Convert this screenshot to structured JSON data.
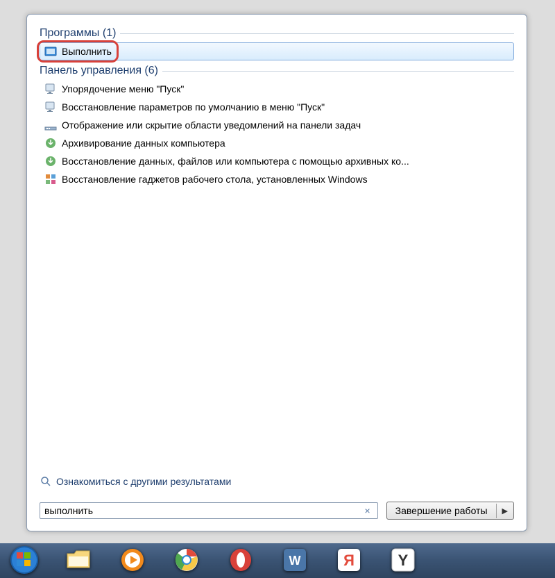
{
  "sections": {
    "programs": {
      "title": "Программы (1)",
      "items": [
        {
          "label": "Выполнить",
          "icon": "run-icon",
          "selected": true,
          "red_highlight": true
        }
      ]
    },
    "control_panel": {
      "title": "Панель управления (6)",
      "items": [
        {
          "label": "Упорядочение меню \"Пуск\"",
          "icon": "screen-icon"
        },
        {
          "label": "Восстановление параметров по умолчанию в меню \"Пуск\"",
          "icon": "screen-icon"
        },
        {
          "label": "Отображение или скрытие области уведомлений на панели задач",
          "icon": "bar-icon"
        },
        {
          "label": "Архивирование данных компьютера",
          "icon": "backup-icon"
        },
        {
          "label": "Восстановление данных, файлов или компьютера с помощью архивных ко...",
          "icon": "backup-icon"
        },
        {
          "label": "Восстановление гаджетов рабочего стола, установленных Windows",
          "icon": "gadget-icon"
        }
      ]
    }
  },
  "more_results_label": "Ознакомиться с другими результатами",
  "search": {
    "value": "выполнить"
  },
  "shutdown_label": "Завершение работы",
  "taskbar_items": [
    {
      "name": "start-button",
      "icon": "windows-orb"
    },
    {
      "name": "explorer",
      "icon": "folder"
    },
    {
      "name": "media-player",
      "icon": "wmp"
    },
    {
      "name": "chrome",
      "icon": "chrome"
    },
    {
      "name": "opera",
      "icon": "opera"
    },
    {
      "name": "vk",
      "icon": "vk"
    },
    {
      "name": "yandex-app",
      "icon": "ya-red"
    },
    {
      "name": "yandex-browser",
      "icon": "ya-y"
    }
  ]
}
